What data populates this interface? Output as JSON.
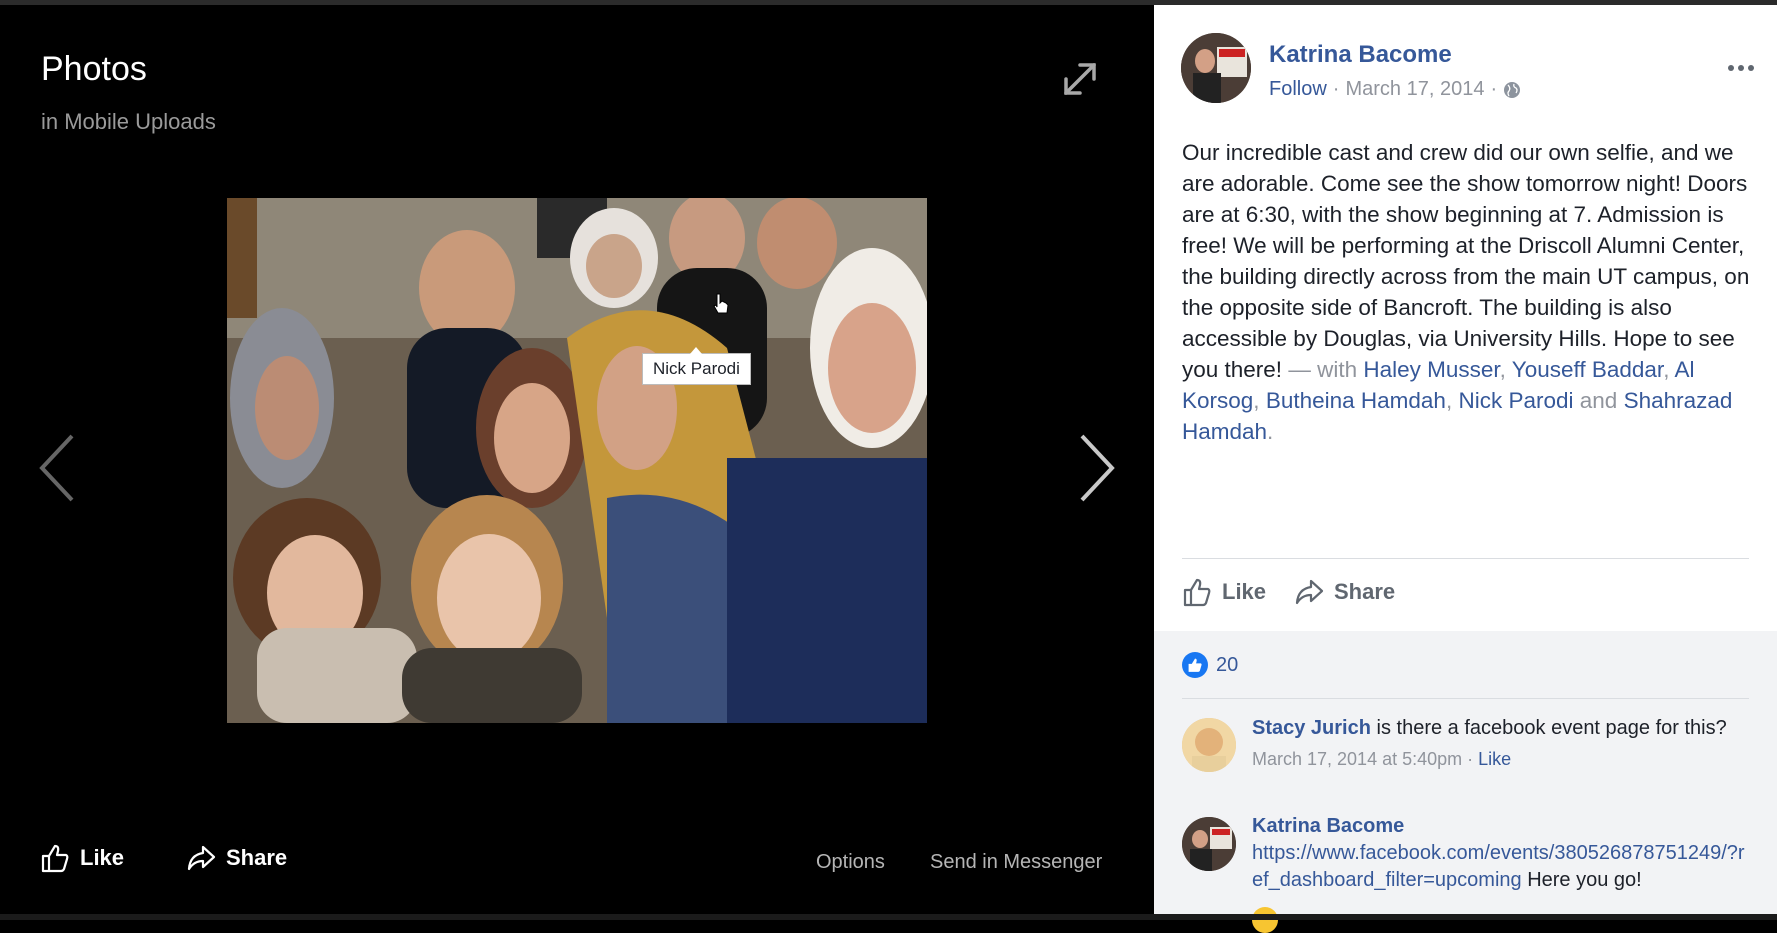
{
  "viewer": {
    "title": "Photos",
    "album": "in Mobile Uploads",
    "tag_label": "Nick Parodi",
    "actions": {
      "like": "Like",
      "share": "Share",
      "options": "Options",
      "send": "Send in Messenger"
    }
  },
  "post": {
    "author": "Katrina Bacome",
    "follow": "Follow",
    "date": "March 17, 2014",
    "body": "Our incredible cast and crew did our own selfie, and we are adorable. Come see the show tomorrow night! Doors are at 6:30, with the show beginning at 7. Admission is free! We will be performing at the Driscoll Alumni Center, the building directly across from the main UT campus, on the opposite side of Bancroft. The building is also accessible by Douglas, via University Hills. Hope to see you there!",
    "with_text": "— with",
    "tagged": [
      "Haley Musser",
      "Youseff Baddar",
      "Al Korsog",
      "Butheina Hamdah",
      "Nick Parodi"
    ],
    "and_text": "and",
    "last_tagged": "Shahrazad Hamdah",
    "period": ".",
    "actions": {
      "like": "Like",
      "share": "Share"
    },
    "like_count": "20"
  },
  "comments": [
    {
      "author": "Stacy Jurich",
      "text": "is there a facebook event page for this?",
      "date": "March 17, 2014 at 5:40pm",
      "like": "Like"
    },
    {
      "author": "Katrina Bacome",
      "link": "https://www.facebook.com/events/380526878751249/?ref_dashboard_filter=upcoming",
      "text": "Here you go!"
    }
  ],
  "colors": {
    "link": "#365899",
    "like_badge": "#1877f2",
    "viewer_bg": "#000000"
  }
}
